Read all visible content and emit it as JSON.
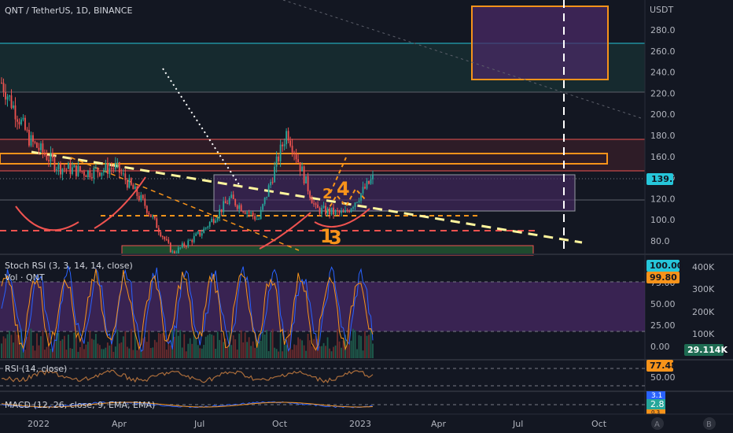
{
  "header": {
    "symbol": "QNT / TetherUS, 1D, BINANCE"
  },
  "price_axis": {
    "unit": "USDT",
    "ticks": [
      "280.0",
      "260.0",
      "240.0",
      "220.0",
      "200.0",
      "180.0",
      "160.0",
      "140.0",
      "120.0",
      "100.0",
      "80.0"
    ],
    "last_price_badge": "139.1"
  },
  "panes": {
    "stoch_rsi": {
      "label": "Stoch RSI (3, 3, 14, 14, close)",
      "vol_label": "Vol · QNT",
      "ticks": [
        "75.00",
        "50.00",
        "25.00",
        "0.00"
      ],
      "badge_k": "100.00",
      "badge_d": "99.80",
      "vol_ticks": [
        "400K",
        "300K",
        "200K",
        "100K"
      ],
      "vol_badge": "29.114K"
    },
    "rsi": {
      "label": "RSI (14, close)",
      "ticks": [
        "50.00"
      ],
      "badge": "77.48"
    },
    "macd": {
      "label": "MACD (12, 26, close, 9, EMA, EMA)",
      "badge_1": "3.1",
      "badge_2": "2.8",
      "badge_3": "0.3"
    }
  },
  "time_axis": {
    "labels": [
      "2022",
      "Apr",
      "Jul",
      "Oct",
      "2023",
      "Apr",
      "Jul",
      "Oct"
    ]
  },
  "annotations": {
    "wave_4": "4",
    "wave_3": "3",
    "wave_2": "2",
    "wave_1": "1"
  },
  "bottom_right": {
    "a": "A",
    "b": "B"
  },
  "colors": {
    "background": "#131722",
    "up": "#26a69a",
    "down": "#ef5350",
    "orange": "#f7931a",
    "purple_zone": "#4a2a66",
    "blue_badge": "#2962ff",
    "teal_badge": "#26c6da"
  },
  "chart_data": {
    "type": "line",
    "title": "QNT / TetherUS, 1D, BINANCE",
    "xlabel": "",
    "ylabel": "",
    "x": [
      "2021-12",
      "2022-01",
      "2022-02",
      "2022-03",
      "2022-04",
      "2022-05",
      "2022-06",
      "2022-07",
      "2022-08",
      "2022-09",
      "2022-10",
      "2022-11",
      "2022-12",
      "2023-01"
    ],
    "series": [
      {
        "values": [
          230,
          175,
          150,
          145,
          150,
          115,
          68,
          88,
          120,
          100,
          185,
          110,
          105,
          139
        ]
      }
    ],
    "ylim": [
      65,
      300
    ],
    "grid": true,
    "legend": "none"
  }
}
